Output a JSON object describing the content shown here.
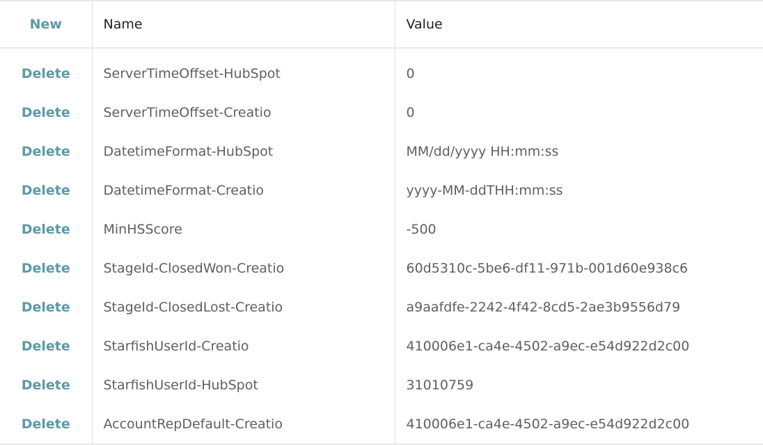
{
  "header": {
    "new_label": "New",
    "name_label": "Name",
    "value_label": "Value"
  },
  "rows": [
    {
      "action": "Delete",
      "name": "ServerTimeOffset-HubSpot",
      "value": "0"
    },
    {
      "action": "Delete",
      "name": "ServerTimeOffset-Creatio",
      "value": "0"
    },
    {
      "action": "Delete",
      "name": "DatetimeFormat-HubSpot",
      "value": "MM/dd/yyyy HH:mm:ss"
    },
    {
      "action": "Delete",
      "name": "DatetimeFormat-Creatio",
      "value": "yyyy-MM-ddTHH:mm:ss"
    },
    {
      "action": "Delete",
      "name": "MinHSScore",
      "value": "-500"
    },
    {
      "action": "Delete",
      "name": "StageId-ClosedWon-Creatio",
      "value": "60d5310c-5be6-df11-971b-001d60e938c6"
    },
    {
      "action": "Delete",
      "name": "StageId-ClosedLost-Creatio",
      "value": "a9aafdfe-2242-4f42-8cd5-2ae3b9556d79"
    },
    {
      "action": "Delete",
      "name": "StarfishUserId-Creatio",
      "value": "410006e1-ca4e-4502-a9ec-e54d922d2c00"
    },
    {
      "action": "Delete",
      "name": "StarfishUserId-HubSpot",
      "value": "31010759"
    },
    {
      "action": "Delete",
      "name": "AccountRepDefault-Creatio",
      "value": "410006e1-ca4e-4502-a9ec-e54d922d2c00"
    }
  ],
  "colors": {
    "link": "#5b9aa6",
    "text": "#5f5f5f",
    "header_text": "#1e1e1e",
    "border": "#e8e8e8"
  }
}
